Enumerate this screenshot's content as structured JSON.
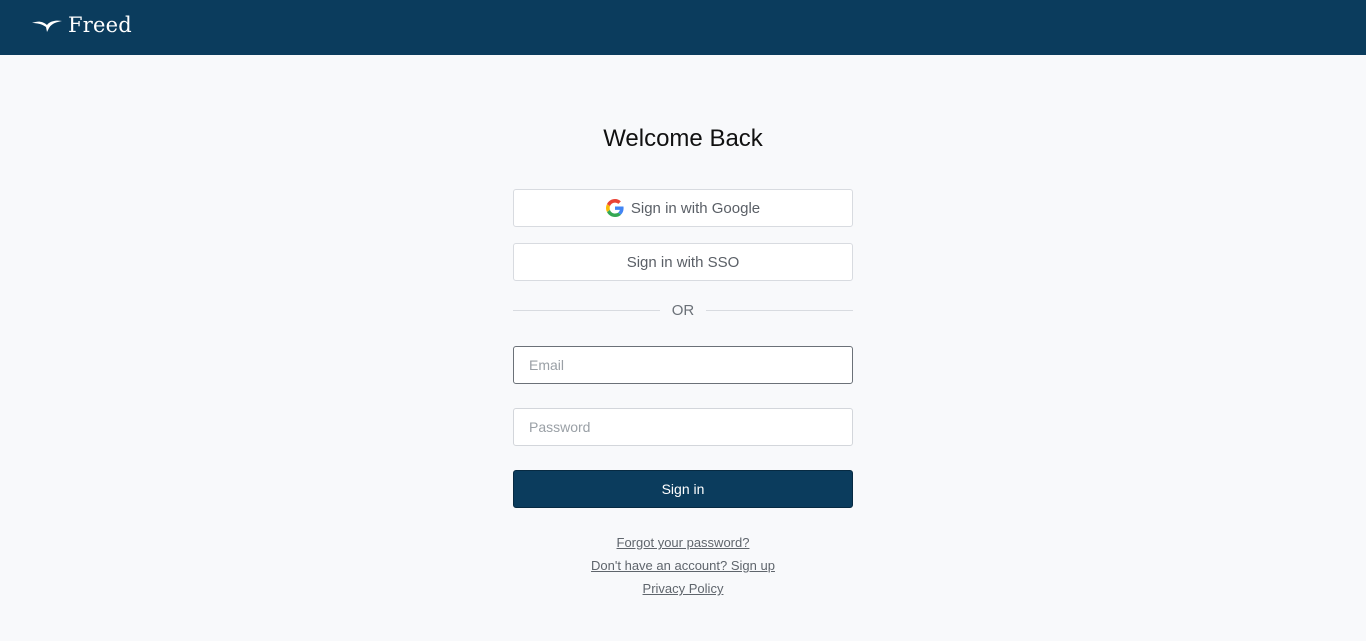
{
  "header": {
    "brand": "Freed",
    "bg_color": "#0b3c5d"
  },
  "login": {
    "title": "Welcome Back",
    "google_label": "Sign in with Google",
    "sso_label": "Sign in with SSO",
    "divider_text": "OR",
    "email_placeholder": "Email",
    "password_placeholder": "Password",
    "submit_label": "Sign in",
    "links": {
      "forgot": "Forgot your password?",
      "signup": "Don't have an account? Sign up",
      "privacy": "Privacy Policy"
    }
  },
  "icons": {
    "logo": "freed-bird-logo-icon",
    "google": "google-g-icon"
  }
}
